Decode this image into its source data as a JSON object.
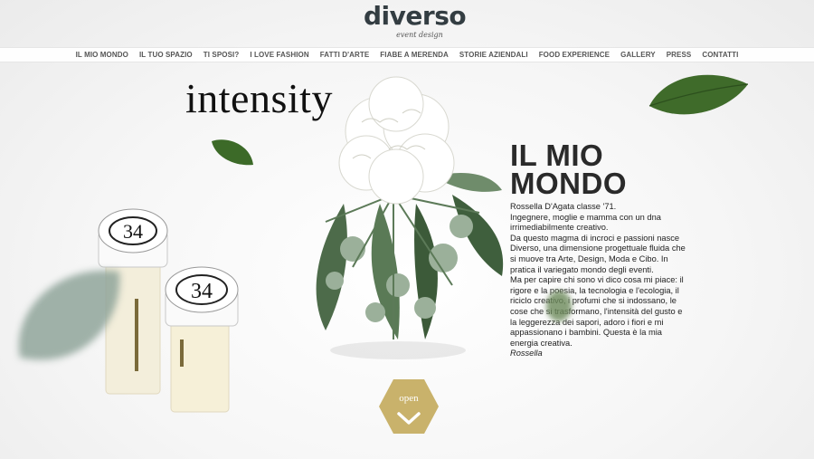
{
  "brand": {
    "name": "diverso",
    "tagline": "event design"
  },
  "nav": {
    "items": [
      {
        "label": "IL MIO MONDO"
      },
      {
        "label": "IL TUO SPAZIO"
      },
      {
        "label": "TI SPOSI?"
      },
      {
        "label": "I LOVE FASHION"
      },
      {
        "label": "FATTI D'ARTE"
      },
      {
        "label": "FIABE A MERENDA"
      },
      {
        "label": "STORIE AZIENDALI"
      },
      {
        "label": "FOOD EXPERIENCE"
      },
      {
        "label": "GALLERY"
      },
      {
        "label": "PRESS"
      },
      {
        "label": "CONTATTI"
      }
    ]
  },
  "hero": {
    "word": "intensity",
    "perfume_labels": [
      "34",
      "34"
    ]
  },
  "section": {
    "title_line1": "IL MIO",
    "title_line2": "MONDO",
    "paragraphs": [
      "Rossella D'Agata classe '71.",
      "Ingegnere, moglie e mamma con un dna irrimediabilmente creativo.",
      "Da questo magma di incroci e passioni nasce Diverso, una dimensione progettuale fluida che si muove tra Arte, Design, Moda e Cibo. In pratica il variegato mondo degli eventi.",
      "Ma per capire chi sono vi dico cosa mi piace: il rigore e la poesia, la tecnologia e l'ecologia, il riciclo creativo, i profumi che si indossano, le cose che si trasformano, l'intensità del gusto e la leggerezza dei sapori, adoro i fiori e mi appassionano i bambini. Questa è la mia energia creativa."
    ],
    "signature": "Rossella"
  },
  "open_button": {
    "label": "open",
    "icon": "chevron-down-icon"
  },
  "colors": {
    "gold": "#c9b26b",
    "leaf_green": "#3e6a2c",
    "text_dark": "#2a2a2a"
  }
}
